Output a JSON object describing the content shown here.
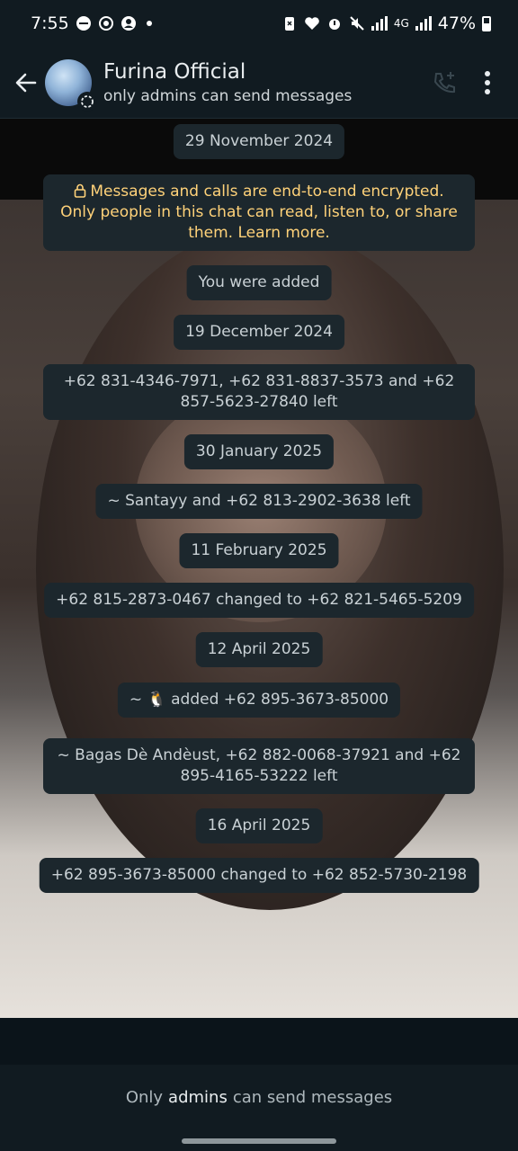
{
  "status_bar": {
    "time": "7:55",
    "network": "4G",
    "battery": "47%",
    "left_icons": [
      "minus-circle-icon",
      "sync-icon",
      "account-icon",
      "dot-icon"
    ],
    "right_icons": [
      "battery-saver-icon",
      "heart-icon",
      "alarm-icon",
      "mute-icon",
      "signal-icon",
      "signal-icon",
      "battery-icon"
    ]
  },
  "header": {
    "title": "Furina Official",
    "subtitle": "only admins can send messages",
    "actions": [
      "add-call-icon",
      "more-vert-icon"
    ]
  },
  "messages": [
    {
      "text": "29 November 2024"
    },
    {
      "text": "Messages and calls are end-to-end encrypted. Only people in this chat can read, listen to, or share them. Learn more."
    },
    {
      "text": "You were added"
    },
    {
      "text": "19 December 2024"
    },
    {
      "text": "+62 831-4346-7971, +62 831-8837-3573 and +62 857-5623-27840 left"
    },
    {
      "text": "30 January 2025"
    },
    {
      "text": "~ Santayy and +62 813-2902-3638 left"
    },
    {
      "text": "11 February 2025"
    },
    {
      "text": "+62 815-2873-0467 changed to +62 821-5465-5209"
    },
    {
      "text": "12 April 2025"
    },
    {
      "text": "~ 🐧 added +62 895-3673-85000"
    },
    {
      "text": "~ Bagas Dè Andèust, +62 882-0068-37921 and +62 895-4165-53222 left"
    },
    {
      "text": "16 April 2025"
    },
    {
      "text": "+62 895-3673-85000 changed to +62 852-5730-2198"
    }
  ],
  "footer": {
    "prefix": "Only",
    "emphasis": "admins",
    "suffix": "can send messages"
  }
}
